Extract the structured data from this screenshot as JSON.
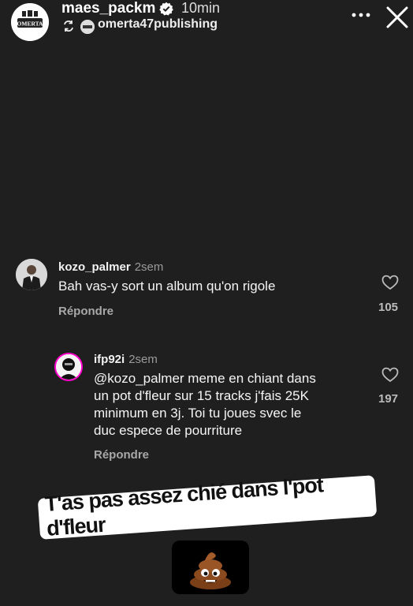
{
  "header": {
    "username": "maes_packm",
    "time": "10min",
    "audio_label": "omerta47publishing",
    "avatar_logo_text": "OMERTA"
  },
  "comments": [
    {
      "username": "kozo_palmer",
      "time": "2sem",
      "text_lines": [
        "Bah vas-y sort un album qu'on rigole"
      ],
      "reply_label": "Répondre",
      "likes": "105"
    },
    {
      "username": "ifp92i",
      "time": "2sem",
      "text_lines": [
        "@kozo_palmer meme en chiant dans",
        "un pot d'fleur sur 15 tracks j'fais 25K",
        "minimum en 3j. Toi tu joues svec le",
        "duc espece de pourriture"
      ],
      "reply_label": "Répondre",
      "likes": "197"
    }
  ],
  "sticker": {
    "caption": "T'as pas assez chié dans l'pot d'fleur",
    "emoji": "poop-emoji"
  },
  "colors": {
    "background": "#1f1f1f",
    "text": "#ffffff",
    "secondary": "#a8a8a8",
    "caption_bg": "#ffffff",
    "emoji_brown": "#8b4a1e"
  }
}
